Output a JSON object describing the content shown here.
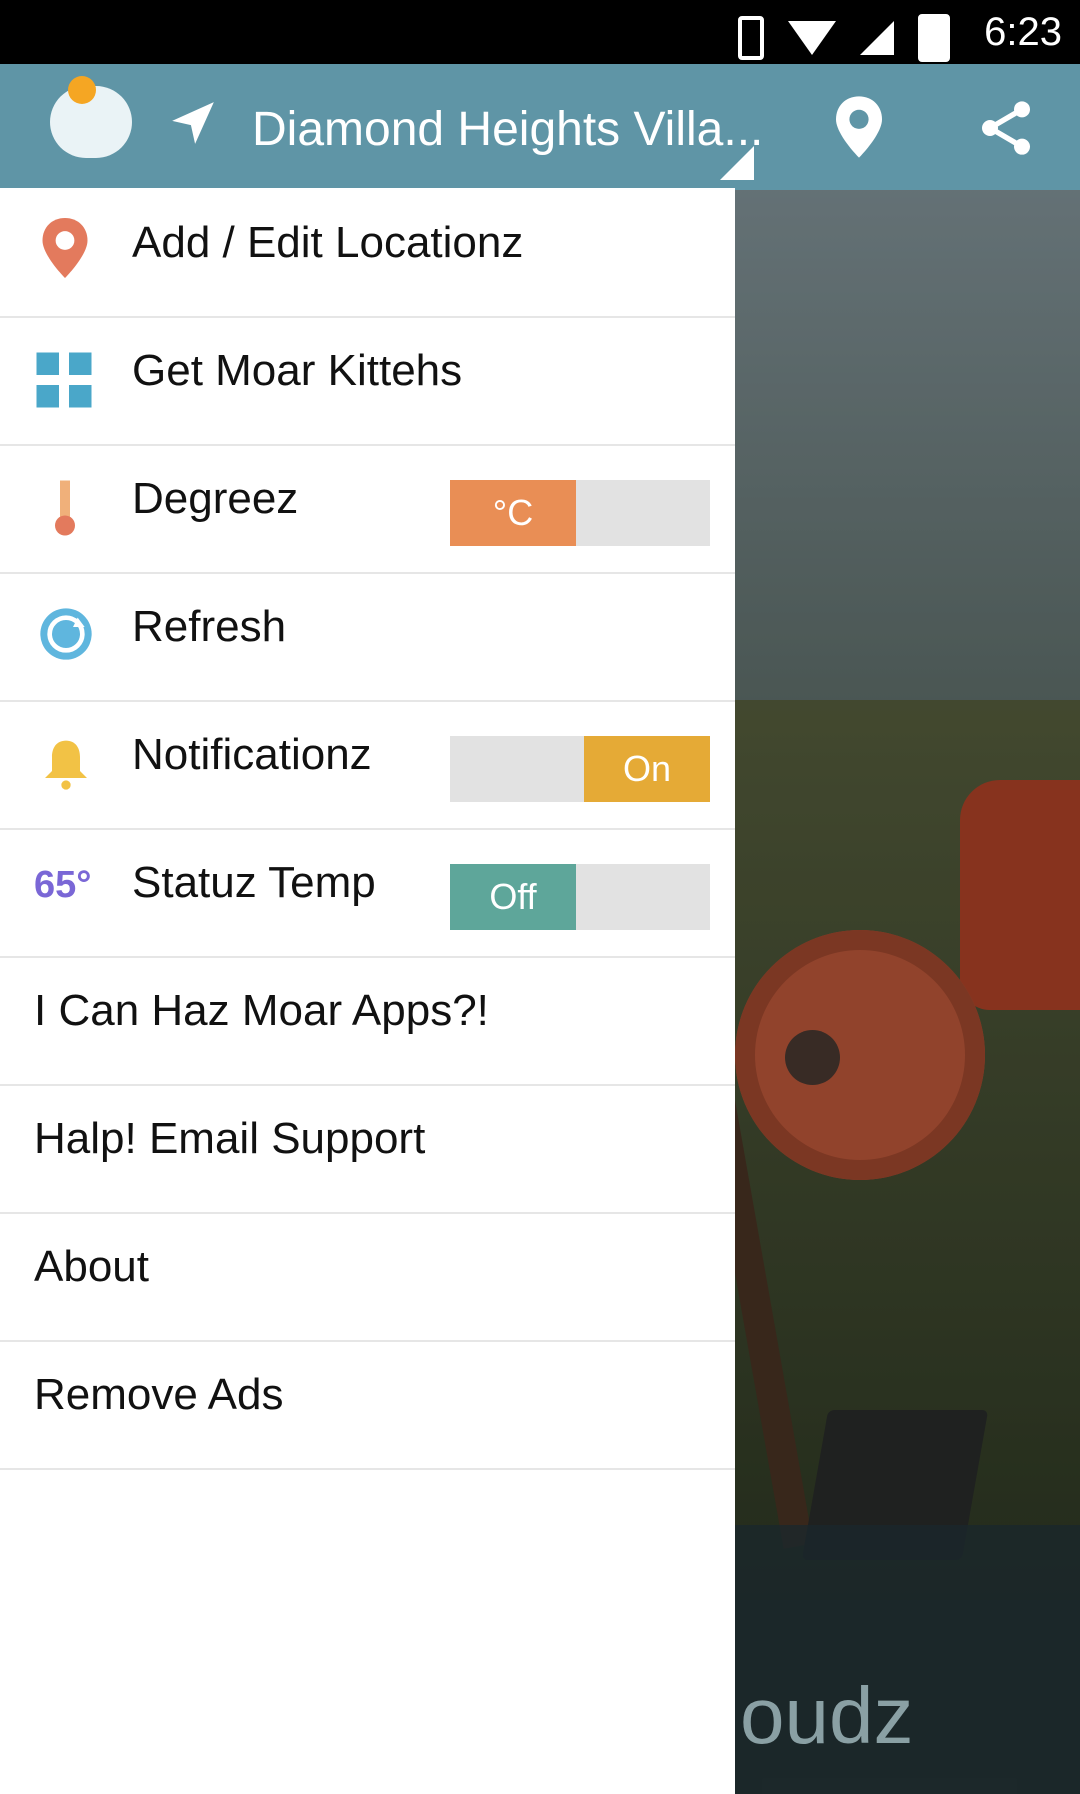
{
  "statusbar": {
    "time": "6:23"
  },
  "toolbar": {
    "location_title": "Diamond Heights Villa..."
  },
  "drawer": {
    "items": [
      {
        "label": "Add / Edit Locationz",
        "icon": "map-pin-icon"
      },
      {
        "label": "Get Moar Kittehs",
        "icon": "plus-icon"
      },
      {
        "label": "Degreez",
        "icon": "thermometer-icon",
        "toggle": {
          "selected": "°C"
        }
      },
      {
        "label": "Refresh",
        "icon": "refresh-icon"
      },
      {
        "label": "Notificationz",
        "icon": "bell-icon",
        "toggle": {
          "selected": "On"
        }
      },
      {
        "label": "Statuz Temp",
        "icon": "temperature-badge-icon",
        "badge": "65°",
        "toggle": {
          "selected": "Off"
        }
      },
      {
        "label": "I Can Haz Moar Apps?!"
      },
      {
        "label": "Halp! Email Support"
      },
      {
        "label": "About"
      },
      {
        "label": "Remove Ads"
      }
    ]
  },
  "background": {
    "partial_brand": "oudz"
  },
  "colors": {
    "toolbar": "#5f95a6",
    "degrees_toggle": "#e98e55",
    "notifications_toggle": "#e5aa36",
    "status_toggle": "#5ea69a"
  }
}
